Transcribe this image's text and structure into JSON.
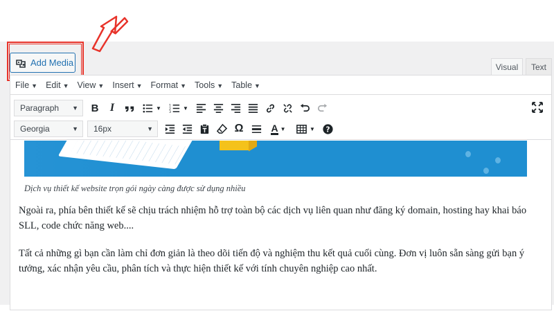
{
  "add_media": {
    "label": "Add Media"
  },
  "tabs": [
    {
      "label": "Visual",
      "active": true
    },
    {
      "label": "Text",
      "active": false
    }
  ],
  "menubar": [
    {
      "label": "File"
    },
    {
      "label": "Edit"
    },
    {
      "label": "View"
    },
    {
      "label": "Insert"
    },
    {
      "label": "Format"
    },
    {
      "label": "Tools"
    },
    {
      "label": "Table"
    }
  ],
  "toolbar1": {
    "format_select": "Paragraph",
    "buttons": [
      "bold-icon",
      "italic-icon",
      "blockquote-icon",
      "bullet-list-icon",
      "numbered-list-icon",
      "align-left-icon",
      "align-center-icon",
      "align-right-icon",
      "justify-icon",
      "link-icon",
      "unlink-icon",
      "undo-icon",
      "redo-icon",
      "fullscreen-icon"
    ]
  },
  "toolbar2": {
    "font_family": "Georgia",
    "font_size": "16px",
    "buttons": [
      "indent-icon",
      "outdent-icon",
      "paste-text-icon",
      "clear-formatting-icon",
      "special-character-icon",
      "horizontal-line-icon",
      "text-color-icon",
      "table-icon",
      "help-icon"
    ],
    "text_color_letter": "A",
    "special_char_symbol": "Ω",
    "bold_letter": "B",
    "italic_letter": "I"
  },
  "content": {
    "caption": "Dịch vụ thiết kế website trọn gói ngày càng được sử dụng nhiều",
    "paragraphs": [
      "Ngoài ra, phía bên thiết kế sẽ chịu trách nhiệm hỗ trợ toàn bộ các dịch vụ liên quan như đăng ký domain, hosting hay khai báo SLL, code chức năng web....",
      "Tất cả những gì bạn cần làm chỉ đơn giản là theo dõi tiến độ và nghiệm thu kết quả cuối cùng. Đơn vị luôn sẵn sàng gửi bạn ý tưởng, xác nhận yêu cầu, phân tích và thực hiện thiết kế với tính chuyên nghiệp cao nhất."
    ]
  },
  "colors": {
    "accent": "#2271b1",
    "annotation": "#e8332a",
    "hero_blue": "#1f8fd1",
    "admin_bg": "#f0f0f1"
  }
}
